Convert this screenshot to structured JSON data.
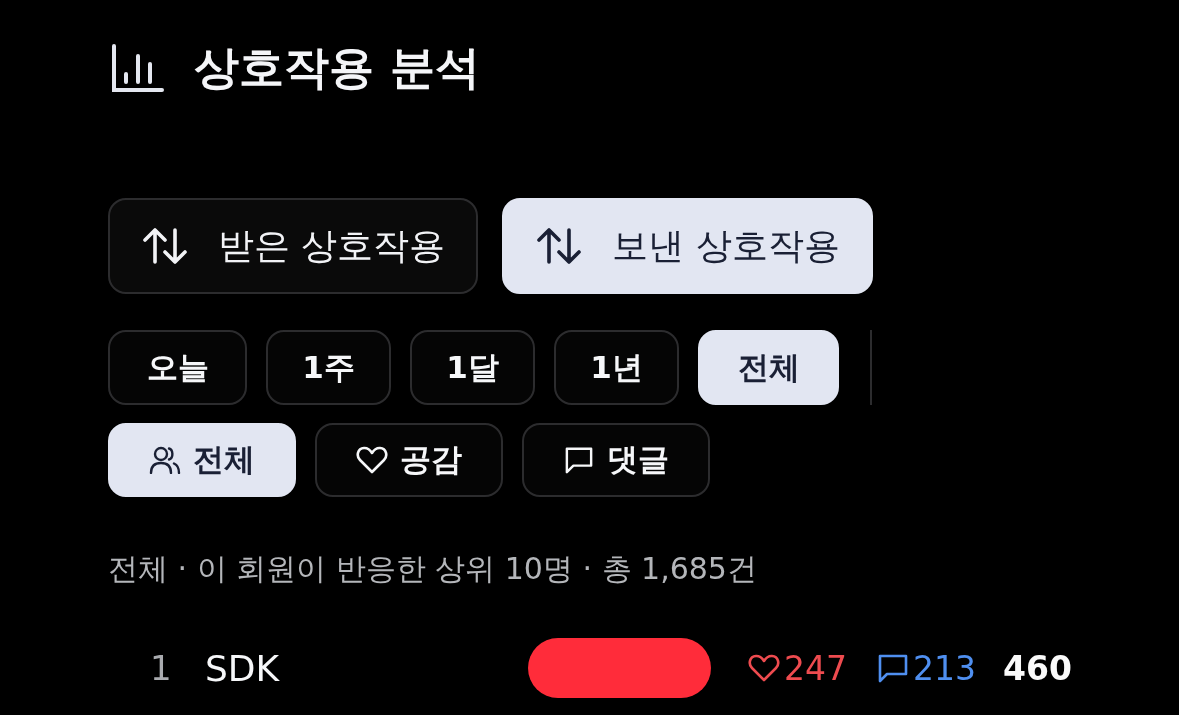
{
  "header": {
    "title": "상호작용 분석"
  },
  "direction_tabs": [
    {
      "label": "받은 상호작용",
      "selected": false
    },
    {
      "label": "보낸 상호작용",
      "selected": true
    }
  ],
  "period_filters": [
    {
      "label": "오늘",
      "selected": false
    },
    {
      "label": "1주",
      "selected": false
    },
    {
      "label": "1달",
      "selected": false
    },
    {
      "label": "1년",
      "selected": false
    },
    {
      "label": "전체",
      "selected": true
    }
  ],
  "type_filters": [
    {
      "kind": "all",
      "label": "전체",
      "selected": true
    },
    {
      "kind": "like",
      "label": "공감",
      "selected": false
    },
    {
      "kind": "comment",
      "label": "댓글",
      "selected": false
    }
  ],
  "summary": "전체 · 이 회원이 반응한 상위 10명 · 총 1,685건",
  "ranking": [
    {
      "rank": "1",
      "name": "SDK",
      "likes": "247",
      "comments": "213",
      "total": "460"
    }
  ]
}
